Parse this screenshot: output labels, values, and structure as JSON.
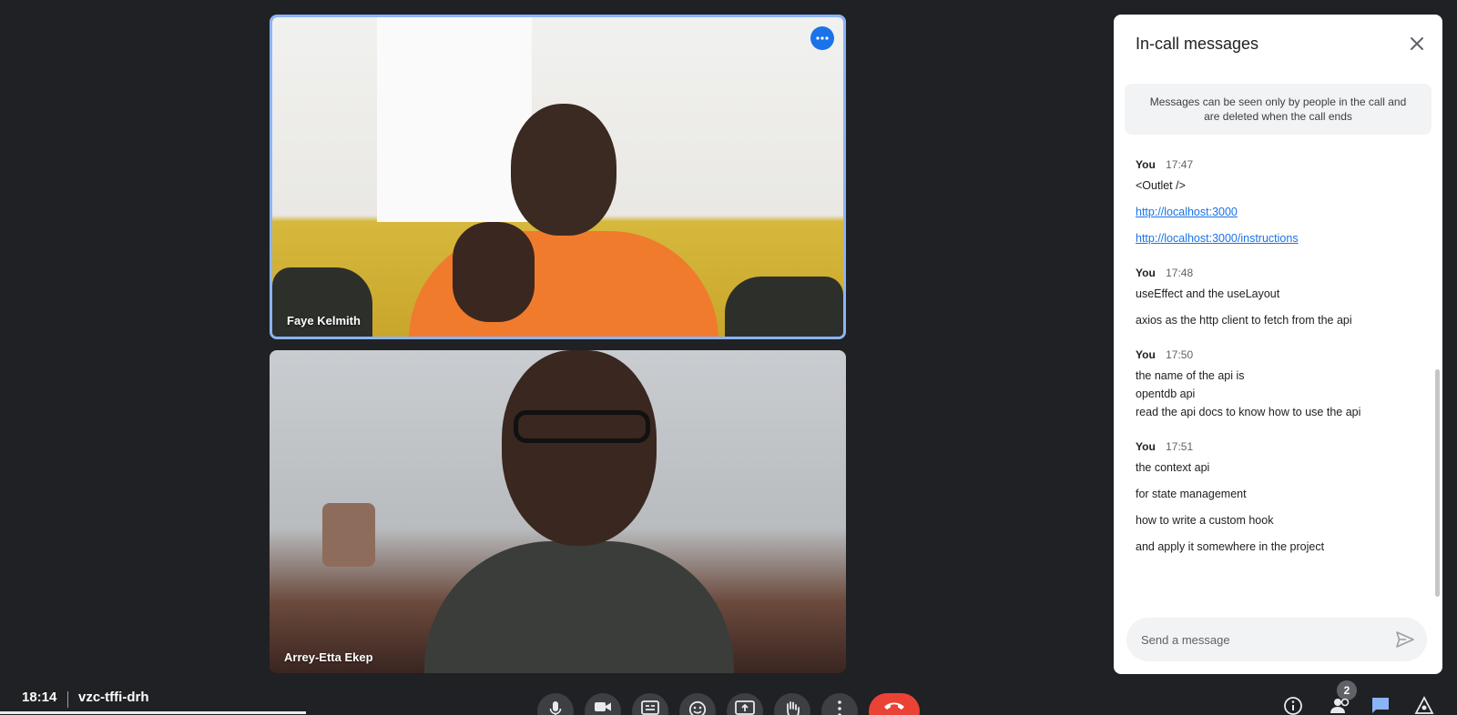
{
  "tiles": [
    {
      "name": "Faye Kelmith"
    },
    {
      "name": "Arrey-Etta Ekep"
    }
  ],
  "chat": {
    "title": "In-call messages",
    "notice": "Messages can be seen only by people in the call and are deleted when the call ends",
    "groups": [
      {
        "sender": "You",
        "time": "17:47",
        "lines": [
          "<Outlet />",
          "http://localhost:3000",
          "http://localhost:3000/instructions"
        ]
      },
      {
        "sender": "You",
        "time": "17:48",
        "lines": [
          "useEffect and the useLayout",
          "axios as the http client to fetch from the api"
        ]
      },
      {
        "sender": "You",
        "time": "17:50",
        "lines": [
          "the name of the api is",
          "opentdb api",
          "read the api docs to know how to use the api"
        ]
      },
      {
        "sender": "You",
        "time": "17:51",
        "lines": [
          "the context api",
          "for state management",
          "how to write a custom hook",
          "and apply it somewhere in the project"
        ]
      }
    ],
    "input_placeholder": "Send a message"
  },
  "bottom_bar": {
    "time": "18:14",
    "meeting_code": "vzc-tffi-drh",
    "participants_count": "2"
  },
  "icons": {
    "tile_more": "more-horizontal-icon",
    "close": "close-icon",
    "send": "send-icon",
    "mic": "microphone-icon",
    "camera": "camera-icon",
    "captions": "captions-icon",
    "reactions": "emoji-icon",
    "present": "present-screen-icon",
    "raise_hand": "raise-hand-icon",
    "more": "more-vertical-icon",
    "end_call": "end-call-icon",
    "info": "info-icon",
    "people": "people-icon",
    "chat": "chat-icon",
    "activities": "activities-icon"
  },
  "colors": {
    "background": "#202124",
    "accent_blue": "#1a73e8",
    "active_border": "#8ab4f8",
    "end_call_red": "#ea4335",
    "link_blue": "#1a73e8"
  }
}
